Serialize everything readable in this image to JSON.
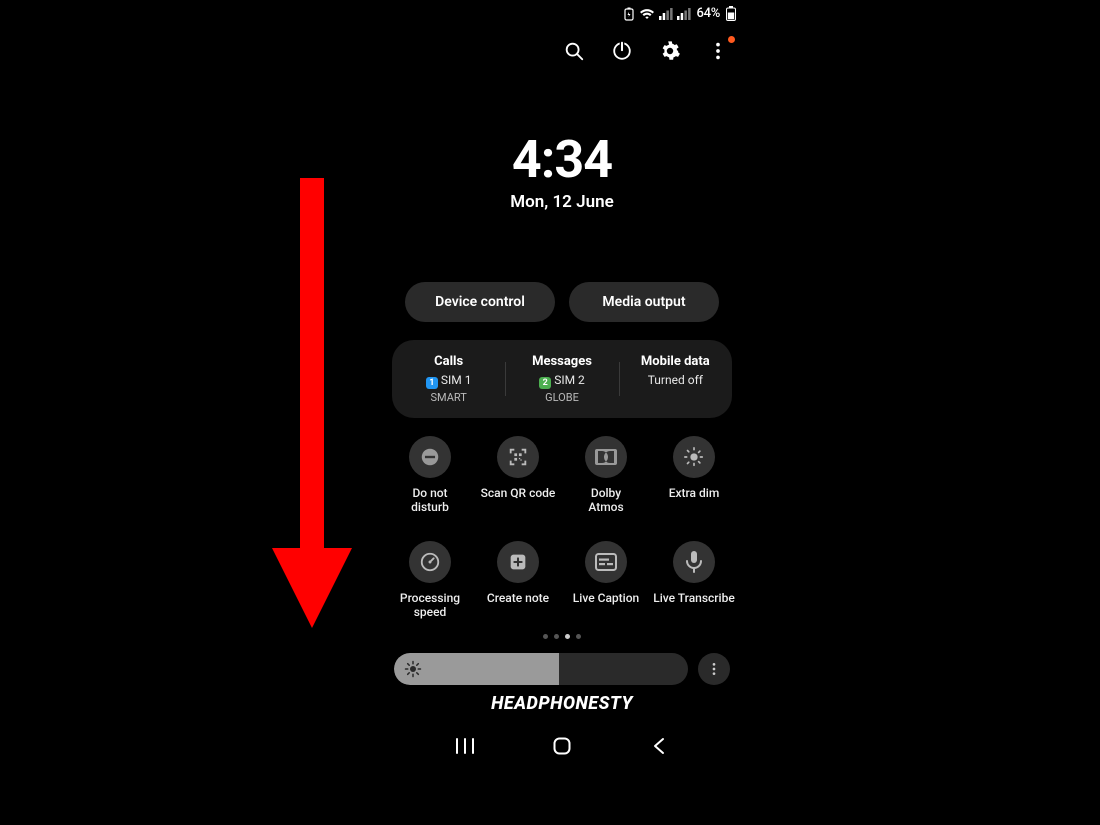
{
  "status": {
    "battery_percent": "64%"
  },
  "toolbar": {
    "search": "search",
    "power": "power",
    "settings": "settings",
    "more": "more"
  },
  "clock": {
    "time": "4:34",
    "date": "Mon, 12 June"
  },
  "pills": {
    "device_control": "Device control",
    "media_output": "Media output"
  },
  "sim": {
    "calls": {
      "title": "Calls",
      "sim_num": "1",
      "sim_label": "SIM 1",
      "carrier": "SMART"
    },
    "messages": {
      "title": "Messages",
      "sim_num": "2",
      "sim_label": "SIM 2",
      "carrier": "GLOBE"
    },
    "data": {
      "title": "Mobile data",
      "state": "Turned off"
    }
  },
  "tiles": [
    {
      "id": "dnd",
      "label": "Do not\ndisturb"
    },
    {
      "id": "qr",
      "label": "Scan QR code"
    },
    {
      "id": "dolby",
      "label": "Dolby\nAtmos"
    },
    {
      "id": "extradim",
      "label": "Extra dim"
    },
    {
      "id": "procspeed",
      "label": "Processing\nspeed"
    },
    {
      "id": "createnote",
      "label": "Create note"
    },
    {
      "id": "livecaption",
      "label": "Live Caption"
    },
    {
      "id": "livetrans",
      "label": "Live Transcribe"
    }
  ],
  "pager": {
    "pages": 4,
    "active": 2
  },
  "brightness": {
    "percent": 56
  },
  "watermark": "HEADPHONESTY",
  "colors": {
    "accent_red": "#ff0000"
  }
}
